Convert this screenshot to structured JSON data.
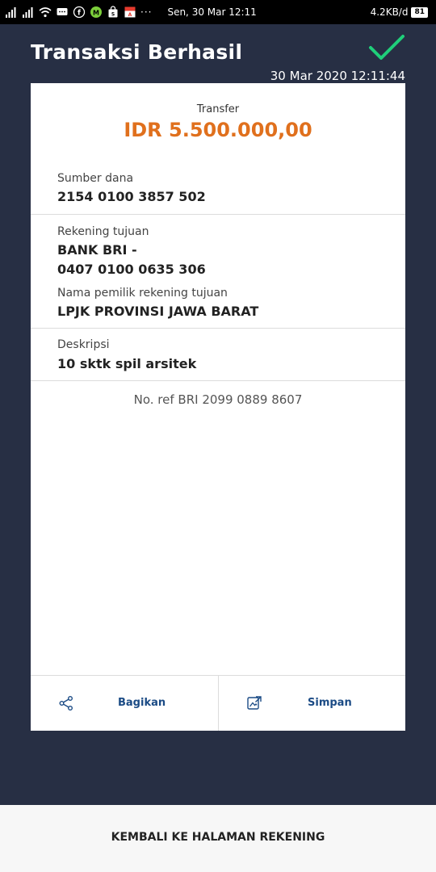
{
  "status_bar": {
    "time": "Sen, 30 Mar 12:11",
    "more": "···",
    "net_speed": "4.2KB/d",
    "battery": "81"
  },
  "header": {
    "title": "Transaksi Berhasil",
    "datetime": "30 Mar 2020 12:11:44",
    "success_icon": "checkmark-icon",
    "success_color": "#1fcf7a"
  },
  "receipt": {
    "type": "Transfer",
    "amount": "IDR 5.500.000,00",
    "amount_color": "#e0701d",
    "source_label": "Sumber dana",
    "source_value": "2154 0100 3857 502",
    "dest_label": "Rekening tujuan",
    "dest_bank": "BANK BRI -",
    "dest_account": "0407 0100 0635 306",
    "owner_label": "Nama pemilik rekening tujuan",
    "owner_value": "LPJK PROVINSI JAWA BARAT",
    "desc_label": "Deskripsi",
    "desc_value": "10 sktk spil arsitek",
    "reference": "No. ref BRI 2099 0889 8607"
  },
  "actions": {
    "share_label": "Bagikan",
    "save_label": "Simpan",
    "accent": "#1b4b85"
  },
  "footer": {
    "back_label": "KEMBALI KE HALAMAN REKENING"
  },
  "colors": {
    "background": "#272f44",
    "card": "#ffffff"
  }
}
